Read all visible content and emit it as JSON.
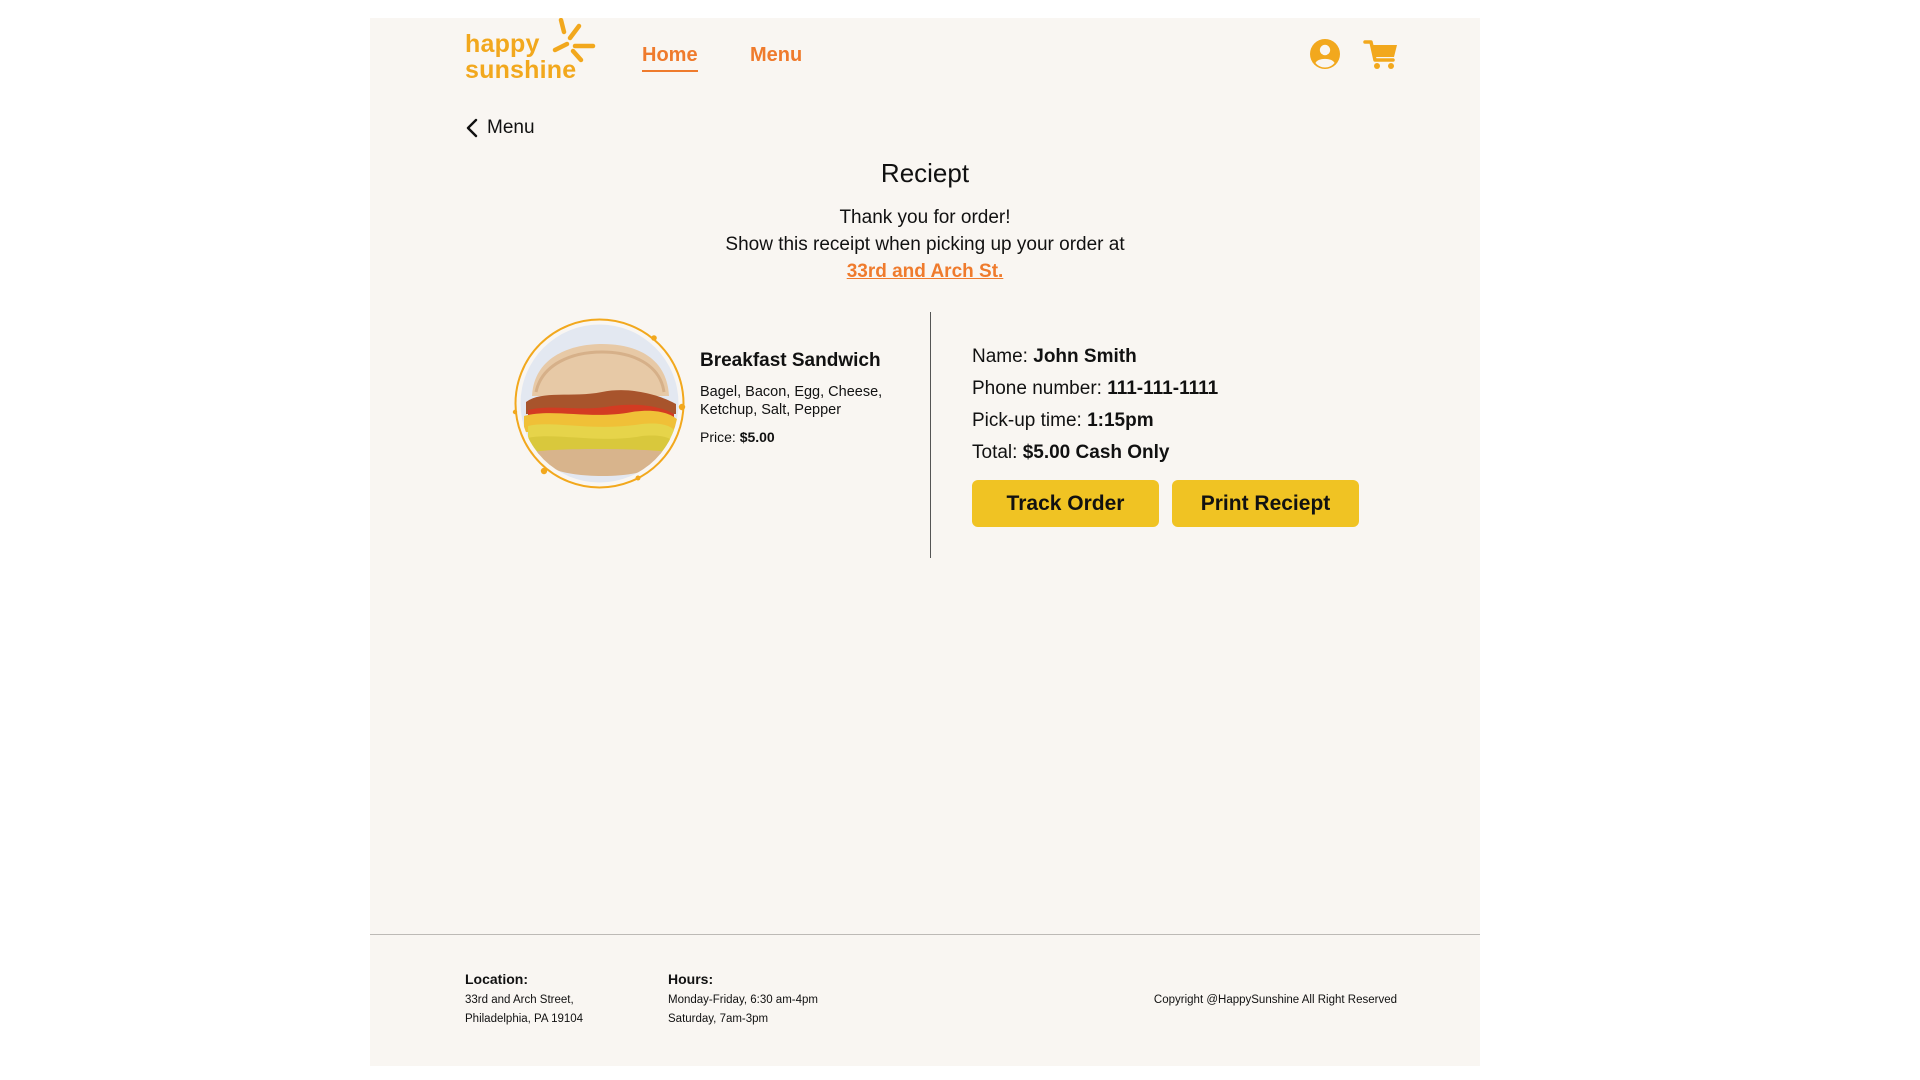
{
  "brand": {
    "logo_line1": "happy",
    "logo_line2": "sunshine",
    "accent_orange": "#ef7b2d",
    "accent_yellow": "#f0c323",
    "logo_color": "#f2a81d"
  },
  "header": {
    "nav": [
      {
        "label": "Home",
        "active": true
      },
      {
        "label": "Menu",
        "active": false
      }
    ],
    "icons": [
      "account-icon",
      "cart-icon"
    ]
  },
  "back_link": {
    "label": "Menu",
    "icon": "chevron-left-icon"
  },
  "receipt": {
    "title": "Reciept",
    "thanks_line1": "Thank you for order!",
    "thanks_line2": "Show this receipt when picking up your order at",
    "pickup_location": "33rd and Arch St."
  },
  "item": {
    "name": "Breakfast Sandwich",
    "ingredients": "Bagel, Bacon, Egg, Cheese, Ketchup, Salt, Pepper",
    "price_label": "Price:",
    "price_value": "$5.00"
  },
  "order": {
    "name_label": "Name:",
    "name_value": "John Smith",
    "phone_label": "Phone number:",
    "phone_value": "111-111-1111",
    "pickup_label": "Pick-up time:",
    "pickup_value": "1:15pm",
    "total_label": "Total:",
    "total_value": "$5.00 Cash Only"
  },
  "buttons": {
    "track": "Track Order",
    "print": "Print Reciept"
  },
  "footer": {
    "location_heading": "Location:",
    "location_line1": "33rd and Arch Street,",
    "location_line2": "Philadelphia, PA 19104",
    "hours_heading": "Hours:",
    "hours_line1": "Monday-Friday, 6:30 am-4pm",
    "hours_line2": "Saturday, 7am-3pm",
    "copyright": "Copyright @HappySunshine All Right Reserved"
  }
}
